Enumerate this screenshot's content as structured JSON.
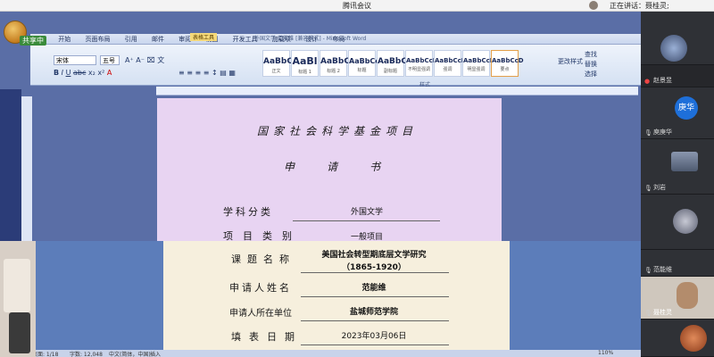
{
  "meeting": {
    "title": "腾讯会议",
    "speaking_label": "正在讲话：",
    "speaker": "聂桂灵;",
    "controls": [
      "—",
      "□",
      "✕"
    ]
  },
  "word": {
    "sharing_badge": "共享中",
    "window_title": "外国文学-范能维 [兼容模式] - Microsoft Word",
    "table_tools": "表格工具",
    "tabs": [
      "开始",
      "页面布局",
      "引用",
      "邮件",
      "审阅",
      "视图",
      "开发工具",
      "加载项",
      "设计",
      "布局"
    ],
    "font_name": "宋体",
    "font_size": "五号",
    "styles": [
      {
        "preview": "AaBbC",
        "name": "正文"
      },
      {
        "preview": "AaBl",
        "name": "标题 1"
      },
      {
        "preview": "AaBbC",
        "name": "标题 2"
      },
      {
        "preview": "AaBbCc",
        "name": "标题"
      },
      {
        "preview": "AaBbC",
        "name": "副标题"
      },
      {
        "preview": "AaBbCcI",
        "name": "不明显强调"
      },
      {
        "preview": "AaBbCcD",
        "name": "强调"
      },
      {
        "preview": "AaBbCcI",
        "name": "明显强调"
      },
      {
        "preview": "AaBbCcD",
        "name": "要点"
      }
    ],
    "style_panel": {
      "change_styles": "更改样式",
      "find": "查找",
      "replace": "替换",
      "select": "选择"
    },
    "section_label": "样式",
    "status": {
      "page": "页面: 1/18",
      "words": "字数: 12,048",
      "lang": "中文(简体，中国)",
      "mode": "插入",
      "zoom": "110%"
    }
  },
  "document": {
    "heading": "国家社会科学基金项目",
    "subheading": "申请书",
    "fields": [
      {
        "label": "学科分类",
        "value": "外国文学"
      },
      {
        "label": "项目类别",
        "value": "一般项目"
      },
      {
        "label": "课题名称",
        "value": "美国社会转型期底层文学研究",
        "value2": "（1865-1920）"
      },
      {
        "label": "申请人姓名",
        "value": "范能维"
      },
      {
        "label": "申请人所在单位",
        "value": "盐城师范学院"
      },
      {
        "label": "填表日期",
        "value": "2023年03月06日"
      }
    ]
  },
  "participants": [
    {
      "name": "",
      "initials": ""
    },
    {
      "name": "赵景昱",
      "initials": ""
    },
    {
      "name": "庾庚华",
      "initials": "庚华"
    },
    {
      "name": "刘岩",
      "initials": ""
    },
    {
      "name": "",
      "initials": ""
    },
    {
      "name": "范能维",
      "initials": ""
    },
    {
      "name": "聂桂灵",
      "initials": ""
    },
    {
      "name": "",
      "initials": ""
    }
  ],
  "colors": {
    "accent_blue": "#1e6fd9",
    "page_purple": "#e8d4f2",
    "page_cream": "#f6efdd"
  }
}
